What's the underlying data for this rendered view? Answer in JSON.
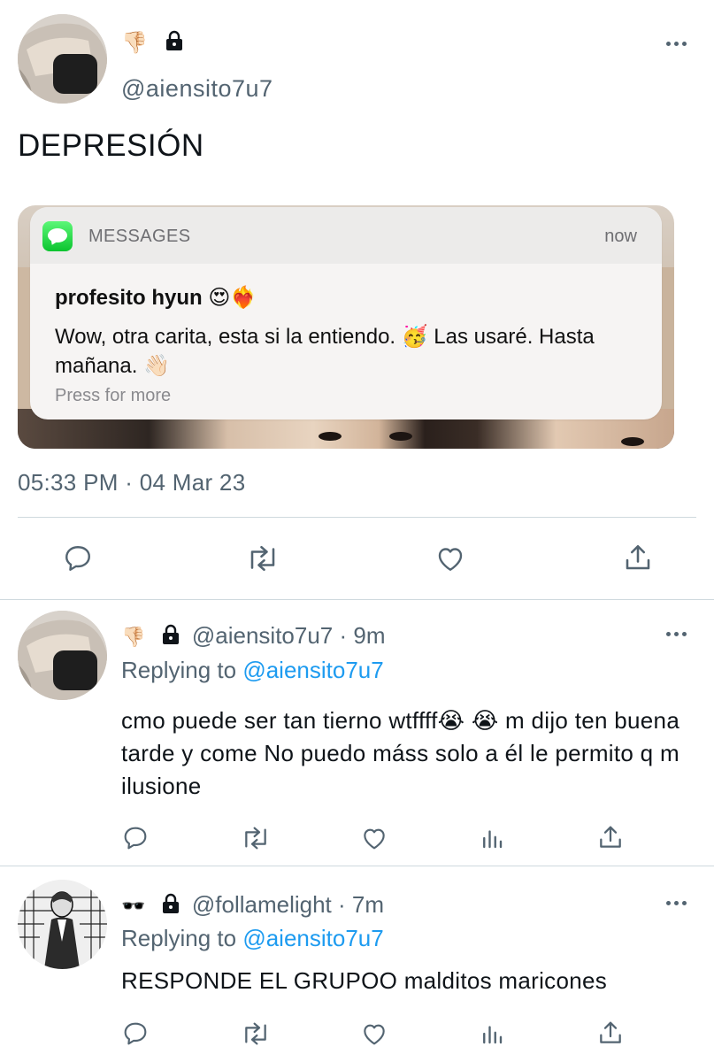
{
  "main_tweet": {
    "name_emojis": "👎🏻",
    "handle": "@aiensito7u7",
    "text": "DEPRESIÓN",
    "timestamp": "05:33 PM · 04 Mar 23"
  },
  "notification": {
    "app": "MESSAGES",
    "time": "now",
    "title": "profesito hyun 😍❤️‍🔥",
    "body": "Wow, otra carita, esta si la entiendo. 🥳 Las usaré. Hasta mañana. 👋🏻",
    "more": "Press for more"
  },
  "replies": [
    {
      "name_emojis": "👎🏻",
      "handle": "@aiensito7u7",
      "time": "9m",
      "replying_prefix": "Replying to",
      "replying_to": "@aiensito7u7",
      "text": "cmo puede ser tan tierno wtffff😭 😭  m dijo ten buena tarde y come No puedo máss solo a él le permito q m ilusione"
    },
    {
      "name_emojis": "🕶️",
      "handle": "@follamelight",
      "time": "7m",
      "replying_prefix": "Replying to",
      "replying_to": "@aiensito7u7",
      "text": "RESPONDE EL GRUPOO malditos maricones"
    }
  ],
  "icons": {
    "reply": "reply-icon",
    "retweet": "retweet-icon",
    "like": "like-icon",
    "share": "share-icon",
    "analytics": "analytics-icon",
    "more": "more-icon",
    "lock": "lock-icon"
  },
  "colors": {
    "text": "#0f1419",
    "secondary": "#536471",
    "link": "#1d9bf0",
    "divider": "#cfd9de",
    "messages_green": "#0bc42f"
  }
}
